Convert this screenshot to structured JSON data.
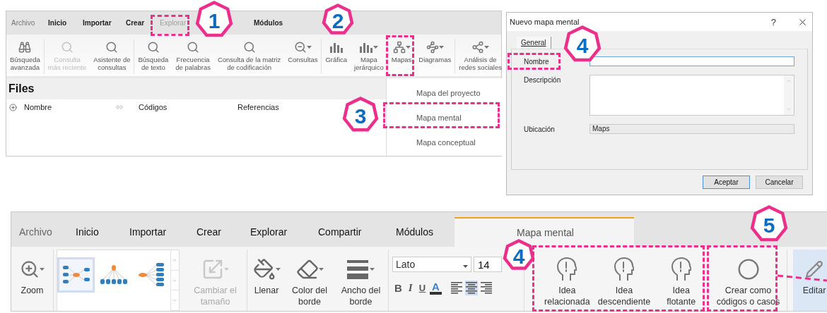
{
  "explore_window": {
    "tabs": [
      {
        "label": "Archivo",
        "kind": "file",
        "selected": false
      },
      {
        "label": "Inicio",
        "kind": "tab",
        "selected": false
      },
      {
        "label": "Importar",
        "kind": "tab",
        "selected": false
      },
      {
        "label": "Crear",
        "kind": "tab",
        "selected": false
      },
      {
        "label": "Explorar",
        "kind": "tab",
        "selected": true
      },
      {
        "label": "Módulos",
        "kind": "tab",
        "selected": false
      }
    ],
    "ribbon_buttons": [
      {
        "label": "Búsqueda\navanzada",
        "kind": "binoculars",
        "disabled": false,
        "dropdown": false
      },
      {
        "label": "Consulta\nmás reciente",
        "kind": "search",
        "disabled": true,
        "dropdown": false
      },
      {
        "label": "Asistente de\nconsultas",
        "kind": "search",
        "disabled": false,
        "dropdown": false
      },
      {
        "label": "Búsqueda\nde texto",
        "kind": "search",
        "disabled": false,
        "dropdown": false
      },
      {
        "label": "Frecuencia\nde palabras",
        "kind": "search",
        "disabled": false,
        "dropdown": false
      },
      {
        "label": "Consulta de la matriz\nde codificación",
        "kind": "search",
        "disabled": false,
        "dropdown": false
      },
      {
        "label": "Consultas",
        "kind": "zoom",
        "disabled": false,
        "dropdown": true
      },
      {
        "label": "Gráfica",
        "kind": "bars",
        "disabled": false,
        "dropdown": false
      },
      {
        "label": "Mapa\njerárquico",
        "kind": "bars",
        "disabled": false,
        "dropdown": true
      },
      {
        "label": "Mapas",
        "kind": "hierarchy",
        "disabled": false,
        "dropdown": true
      },
      {
        "label": "Diagramas",
        "kind": "nodes",
        "disabled": false,
        "dropdown": true
      },
      {
        "label": "Análisis de\nredes sociales",
        "kind": "social",
        "disabled": false,
        "dropdown": true
      }
    ],
    "pane_title": "Files",
    "columns": [
      {
        "label": "Nombre"
      },
      {
        "label": "Códigos"
      },
      {
        "label": "Referencias"
      }
    ],
    "maps_menu": [
      {
        "label": "Mapa del proyecto"
      },
      {
        "label": "Mapa mental"
      },
      {
        "label": "Mapa conceptual"
      }
    ]
  },
  "dialog": {
    "title": "Nuevo mapa mental",
    "help": "?",
    "tabs": [
      {
        "label": "General",
        "selected": true
      }
    ],
    "fields": [
      {
        "label": "Nombre",
        "kind": "text",
        "focused": true
      },
      {
        "label": "Descripción",
        "kind": "textarea",
        "focused": false
      },
      {
        "label": "Ubicación",
        "kind": "readonly",
        "value": "Maps",
        "focused": false
      }
    ],
    "buttons": [
      {
        "label": "Aceptar",
        "default": true
      },
      {
        "label": "Cancelar",
        "default": false
      }
    ]
  },
  "mindmap_window": {
    "tabs": [
      {
        "label": "Archivo",
        "kind": "file",
        "selected": false
      },
      {
        "label": "Inicio",
        "kind": "tab",
        "selected": false
      },
      {
        "label": "Importar",
        "kind": "tab",
        "selected": false
      },
      {
        "label": "Crear",
        "kind": "tab",
        "selected": false
      },
      {
        "label": "Explorar",
        "kind": "tab",
        "selected": false
      },
      {
        "label": "Compartir",
        "kind": "tab",
        "selected": false
      },
      {
        "label": "Módulos",
        "kind": "tab",
        "selected": false
      },
      {
        "label": "Mapa mental",
        "kind": "context",
        "selected": true
      }
    ],
    "zoom": {
      "label": "Zoom"
    },
    "layouts": [
      {
        "kind": "balanced",
        "selected": true
      },
      {
        "kind": "tree",
        "selected": false
      },
      {
        "kind": "right",
        "selected": false
      }
    ],
    "tools": [
      {
        "label": "Cambiar el\ntamaño",
        "kind": "resize",
        "disabled": true
      },
      {
        "label": "Llenar",
        "kind": "fill",
        "disabled": false
      },
      {
        "label": "Color del\nborde",
        "kind": "pen",
        "disabled": false
      },
      {
        "label": "Ancho del\nborde",
        "kind": "width",
        "disabled": false
      }
    ],
    "font": {
      "family": "Lato",
      "size": "14"
    },
    "format": [
      {
        "label": "B",
        "kind": "bold"
      },
      {
        "label": "I",
        "kind": "italic"
      },
      {
        "label": "U",
        "kind": "underline"
      },
      {
        "label": "A",
        "kind": "color"
      }
    ],
    "align": [
      {
        "kind": "left",
        "selected": false
      },
      {
        "kind": "center",
        "selected": true
      },
      {
        "kind": "right",
        "selected": false
      }
    ],
    "ideas": [
      {
        "label": "Idea\nrelacionada"
      },
      {
        "label": "Idea\ndescendiente"
      },
      {
        "label": "Idea\nflotante"
      }
    ],
    "create": {
      "label": "Crear como\ncódigos o casos"
    },
    "edit": {
      "label": "Editar",
      "selected": true
    }
  },
  "callouts": [
    {
      "number": "1"
    },
    {
      "number": "2"
    },
    {
      "number": "3"
    },
    {
      "number": "4"
    },
    {
      "number": "4"
    },
    {
      "number": "5"
    }
  ]
}
